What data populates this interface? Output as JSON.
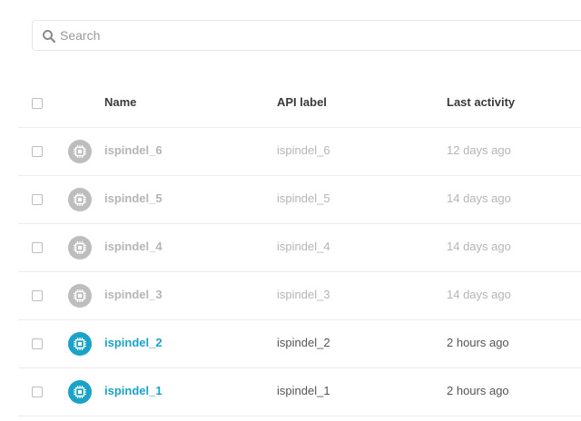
{
  "search": {
    "placeholder": "Search"
  },
  "table": {
    "headers": {
      "name": "Name",
      "api_label": "API label",
      "last_activity": "Last activity"
    },
    "rows": [
      {
        "name": "ispindel_6",
        "api_label": "ispindel_6",
        "last_activity": "12 days ago",
        "status": "inactive"
      },
      {
        "name": "ispindel_5",
        "api_label": "ispindel_5",
        "last_activity": "14 days ago",
        "status": "inactive"
      },
      {
        "name": "ispindel_4",
        "api_label": "ispindel_4",
        "last_activity": "14 days ago",
        "status": "inactive"
      },
      {
        "name": "ispindel_3",
        "api_label": "ispindel_3",
        "last_activity": "14 days ago",
        "status": "inactive"
      },
      {
        "name": "ispindel_2",
        "api_label": "ispindel_2",
        "last_activity": "2 hours ago",
        "status": "active"
      },
      {
        "name": "ispindel_1",
        "api_label": "ispindel_1",
        "last_activity": "2 hours ago",
        "status": "active"
      }
    ]
  },
  "colors": {
    "active_accent": "#1aa3c8",
    "inactive_icon": "#bdbdbd",
    "inactive_text": "#b5b5b5"
  },
  "icons": {
    "search": "search-icon",
    "device": "chip-icon"
  }
}
